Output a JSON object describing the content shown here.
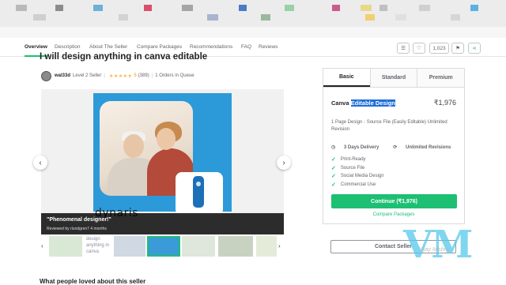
{
  "nav": {
    "tabs": [
      "Overview",
      "Description",
      "About The Seller",
      "Compare Packages",
      "Recommendations",
      "FAQ",
      "Reviews"
    ],
    "like_count": "1,023"
  },
  "gig": {
    "title": "I will design anything in canva editable",
    "seller_name": "wal33d",
    "seller_level": "Level 2 Seller",
    "stars": "★★★★★",
    "rating": "5",
    "review_count": "(389)",
    "orders_in_queue": "1 Orders in Queue"
  },
  "gallery": {
    "logo_text": "dynaris",
    "review_quote": "\"Phenomenal designer!\"",
    "review_by": "Reviewed by rlundgren7 4 months",
    "broken_thumb_text": "design anything in canva"
  },
  "package": {
    "tabs": [
      "Basic",
      "Standard",
      "Premium"
    ],
    "name_prefix": "Canva ",
    "name_highlight": "Editable Design",
    "price": "₹1,976",
    "description": "1 Page Design - Source File (Easily Editable) Unlimited Revision",
    "delivery": "3 Days Delivery",
    "revisions": "Unlimited Revisions",
    "features": [
      "Print-Ready",
      "Source File",
      "Social Media Design",
      "Commercial Use"
    ],
    "continue_label": "Continue (₹1,976)",
    "compare_label": "Compare Packages"
  },
  "contact_label": "Contact Seller",
  "watermark": {
    "big": "VM",
    "small": "Vijay Mishra"
  },
  "bottom_heading": "What people loved about this seller",
  "colors": {
    "accent": "#1dbf73",
    "highlight": "#1e6fd9",
    "star": "#ffb33e"
  }
}
